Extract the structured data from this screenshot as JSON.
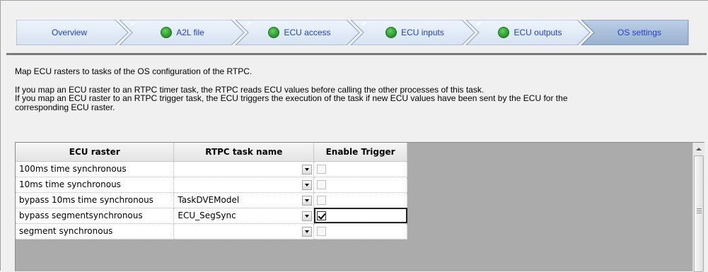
{
  "wizard": {
    "steps": [
      {
        "label": "Overview",
        "completed": false,
        "active": false
      },
      {
        "label": "A2L file",
        "completed": true,
        "active": false
      },
      {
        "label": "ECU access",
        "completed": true,
        "active": false
      },
      {
        "label": "ECU inputs",
        "completed": true,
        "active": false
      },
      {
        "label": "ECU outputs",
        "completed": true,
        "active": false
      },
      {
        "label": "OS settings",
        "completed": false,
        "active": true
      }
    ],
    "icon": "check-circle-icon"
  },
  "description": {
    "line1": "Map ECU rasters to tasks of the OS configuration of the RTPC.",
    "line2": "If you map an ECU raster to an RTPC timer task, the RTPC reads ECU values before calling the other processes of this task.",
    "line3": "If you map an ECU raster to an RTPC trigger task, the ECU triggers the execution of the task if new ECU values have been sent by the ECU for the",
    "line4": "corresponding ECU raster."
  },
  "grid": {
    "columns": [
      "ECU raster",
      "RTPC task name",
      "Enable Trigger"
    ],
    "rows": [
      {
        "raster": "100ms time synchronous",
        "task": "",
        "trigger": false,
        "trigger_enabled": false
      },
      {
        "raster": "10ms time synchronous",
        "task": "",
        "trigger": false,
        "trigger_enabled": false
      },
      {
        "raster": "bypass 10ms time synchronous",
        "task": "TaskDVEModel",
        "trigger": false,
        "trigger_enabled": false
      },
      {
        "raster": "bypass segmentsynchronous",
        "task": "ECU_SegSync",
        "trigger": true,
        "trigger_enabled": true
      },
      {
        "raster": "segment synchronous",
        "task": "",
        "trigger": false,
        "trigger_enabled": false
      }
    ]
  },
  "colors": {
    "step_fill": "#dfe9f5",
    "step_active_fill": "#a9bfd9",
    "step_text": "#1f3fc8",
    "grid_background": "#ababab"
  }
}
